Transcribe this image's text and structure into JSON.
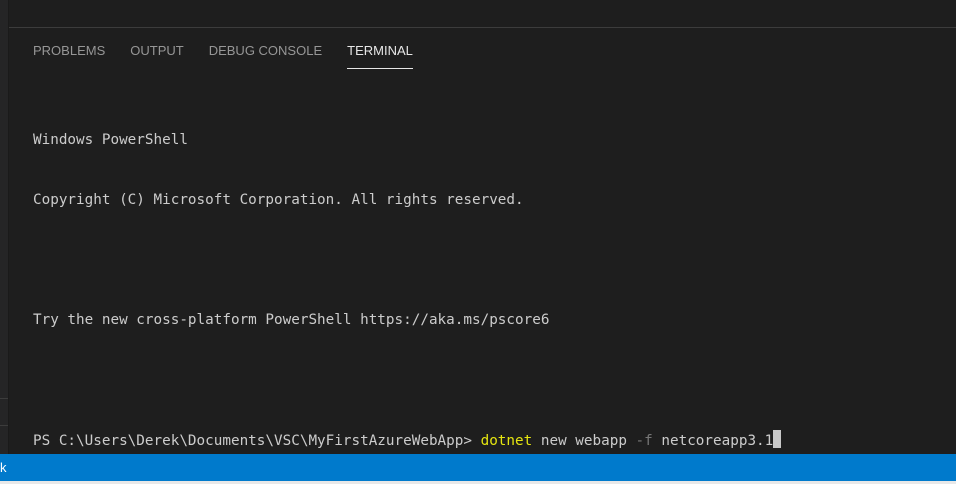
{
  "panel": {
    "tabs": [
      {
        "label": "PROBLEMS",
        "active": false
      },
      {
        "label": "OUTPUT",
        "active": false
      },
      {
        "label": "DEBUG CONSOLE",
        "active": false
      },
      {
        "label": "TERMINAL",
        "active": true
      }
    ]
  },
  "terminal": {
    "lines": [
      "Windows PowerShell",
      "Copyright (C) Microsoft Corporation. All rights reserved.",
      "",
      "Try the new cross-platform PowerShell https://aka.ms/pscore6",
      ""
    ],
    "prompt": "PS C:\\Users\\Derek\\Documents\\VSC\\MyFirstAzureWebApp> ",
    "command": "dotnet",
    "args1": " new webapp ",
    "flag": "-f",
    "args2": " netcoreapp3.1"
  },
  "statusbar": {
    "left_text": "k",
    "color": "#007acc"
  },
  "colors": {
    "background": "#1e1e1e",
    "command": "#e5e510",
    "flag": "#767676",
    "text": "#cccccc"
  }
}
